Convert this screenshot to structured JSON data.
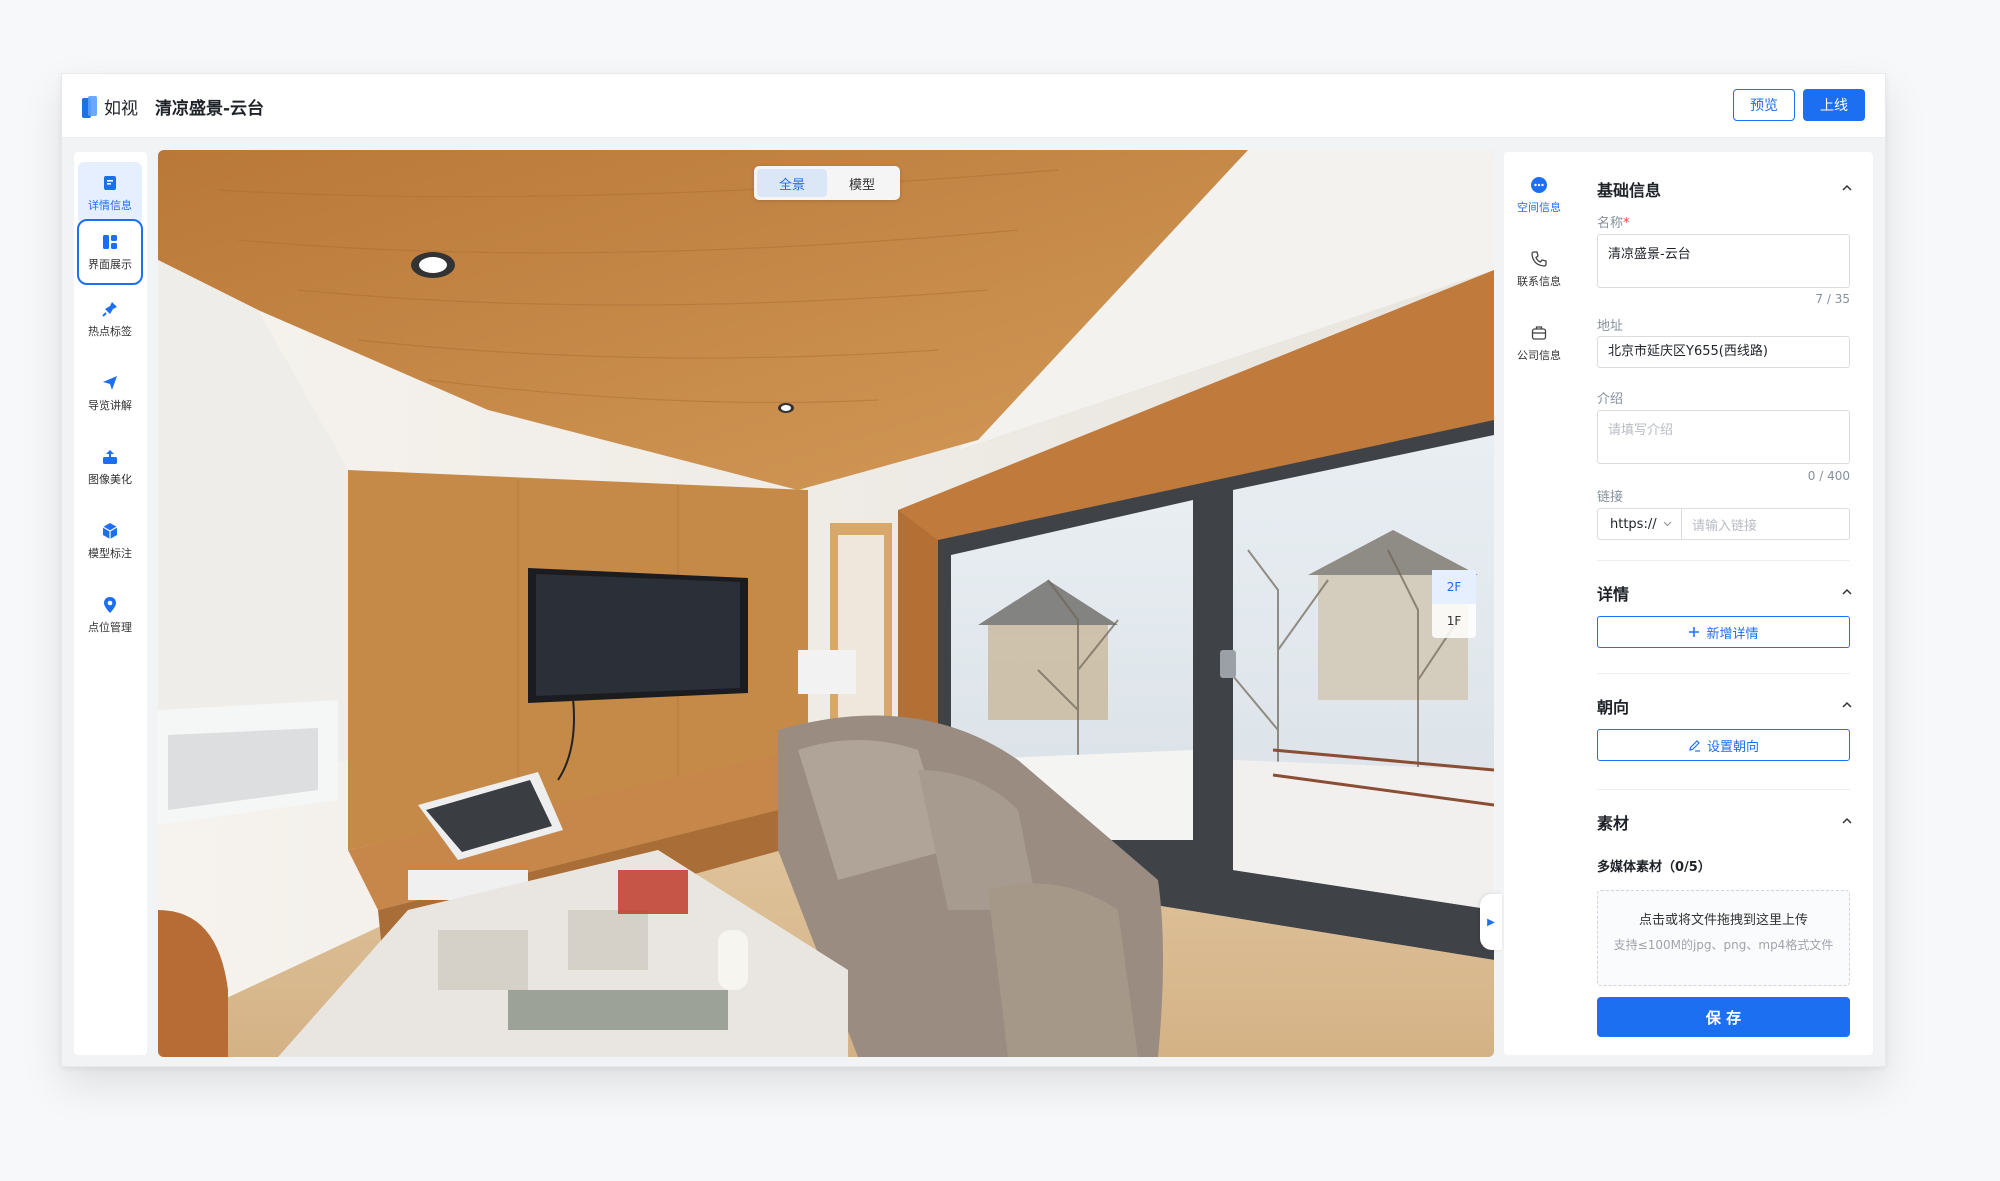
{
  "app": {
    "logo_text": "如视",
    "title": "清凉盛景-云台"
  },
  "header": {
    "preview_label": "预览",
    "publish_label": "上线"
  },
  "left_nav": [
    {
      "label": "详情信息",
      "icon": "document-icon"
    },
    {
      "label": "界面展示",
      "icon": "layout-icon"
    },
    {
      "label": "热点标签",
      "icon": "pin-icon"
    },
    {
      "label": "导览讲解",
      "icon": "send-icon"
    },
    {
      "label": "图像美化",
      "icon": "image-upload-icon"
    },
    {
      "label": "模型标注",
      "icon": "cube-icon"
    },
    {
      "label": "点位管理",
      "icon": "location-icon"
    }
  ],
  "viewer": {
    "mode_tabs": [
      {
        "label": "全景",
        "active": true
      },
      {
        "label": "模型",
        "active": false
      }
    ],
    "floors": [
      {
        "label": "2F",
        "active": true
      },
      {
        "label": "1F",
        "active": false
      }
    ]
  },
  "right_nav": [
    {
      "label": "空间信息",
      "icon": "chat-icon"
    },
    {
      "label": "联系信息",
      "icon": "phone-icon"
    },
    {
      "label": "公司信息",
      "icon": "briefcase-icon"
    }
  ],
  "panel": {
    "basic": {
      "title": "基础信息",
      "name_label": "名称",
      "name_required": "*",
      "name_value": "清凉盛景-云台",
      "name_counter": "7 / 35",
      "address_label": "地址",
      "address_value": "北京市延庆区Y655(西线路)",
      "intro_label": "介绍",
      "intro_placeholder": "请填写介绍",
      "intro_counter": "0 / 400",
      "link_label": "链接",
      "link_protocol": "https://",
      "link_placeholder": "请输入链接"
    },
    "details": {
      "title": "详情",
      "add_label": "新增详情"
    },
    "orientation": {
      "title": "朝向",
      "set_label": "设置朝向"
    },
    "materials": {
      "title": "素材",
      "multimedia_label": "多媒体素材（0/5）",
      "upload_main": "点击或将文件拖拽到这里上传",
      "upload_hint": "支持≤100M的jpg、png、mp4格式文件"
    },
    "save_label": "保 存"
  },
  "colors": {
    "accent": "#1d6ff2",
    "required": "#f53f3f"
  }
}
